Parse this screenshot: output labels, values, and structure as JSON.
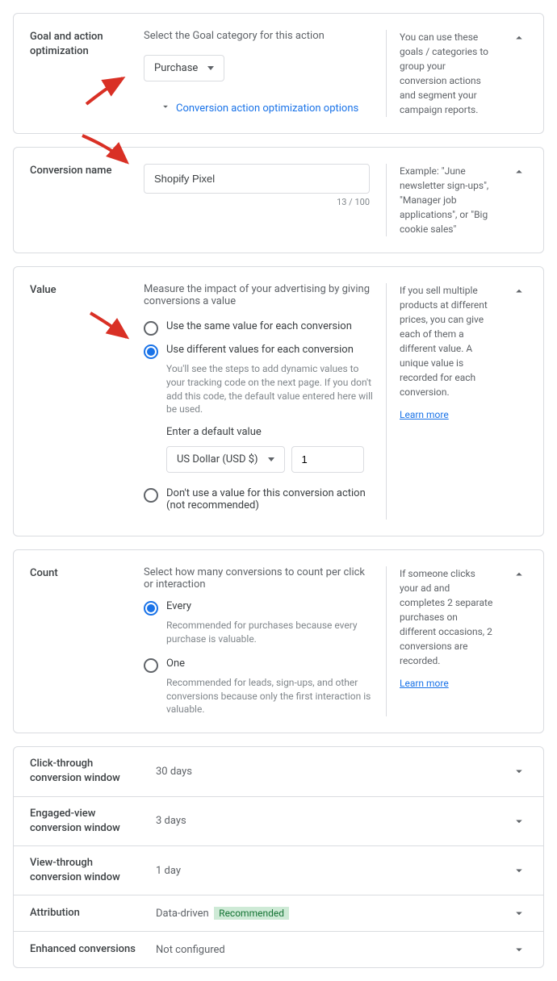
{
  "goal": {
    "title": "Goal and action optimization",
    "hint": "Select the Goal category for this action",
    "selectValue": "Purchase",
    "expandLink": "Conversion action optimization options",
    "help": "You can use these goals / categories to group your conversion actions and segment your campaign reports."
  },
  "name": {
    "title": "Conversion name",
    "value": "Shopify Pixel",
    "counter": "13 / 100",
    "help": "Example: \"June newsletter sign-ups\", \"Manager job applications\", or \"Big cookie sales\""
  },
  "value": {
    "title": "Value",
    "hint": "Measure the impact of your advertising by giving conversions a value",
    "radioSame": "Use the same value for each conversion",
    "radioDiff": "Use different values for each conversion",
    "diffDesc": "You'll see the steps to add dynamic values to your tracking code on the next page. If you don't add this code, the default value entered here will be used.",
    "defaultLabel": "Enter a default value",
    "currency": "US Dollar (USD $)",
    "defaultValue": "1",
    "radioNone": "Don't use a value for this conversion action (not recommended)",
    "help": "If you sell multiple products at different prices, you can give each of them a different value. A unique value is recorded for each conversion.",
    "learnMore": "Learn more"
  },
  "count": {
    "title": "Count",
    "hint": "Select how many conversions to count per click or interaction",
    "radioEvery": "Every",
    "everyDesc": "Recommended for purchases because every purchase is valuable.",
    "radioOne": "One",
    "oneDesc": "Recommended for leads, sign-ups, and other conversions because only the first interaction is valuable.",
    "help": "If someone clicks your ad and completes 2 separate purchases on different occasions, 2 conversions are recorded.",
    "learnMore": "Learn more"
  },
  "collapsed": {
    "clickThrough": {
      "label": "Click-through conversion window",
      "value": "30 days"
    },
    "engagedView": {
      "label": "Engaged-view conversion window",
      "value": "3 days"
    },
    "viewThrough": {
      "label": "View-through conversion window",
      "value": "1 day"
    },
    "attribution": {
      "label": "Attribution",
      "value": "Data-driven",
      "badge": "Recommended"
    },
    "enhanced": {
      "label": "Enhanced conversions",
      "value": "Not configured"
    }
  }
}
